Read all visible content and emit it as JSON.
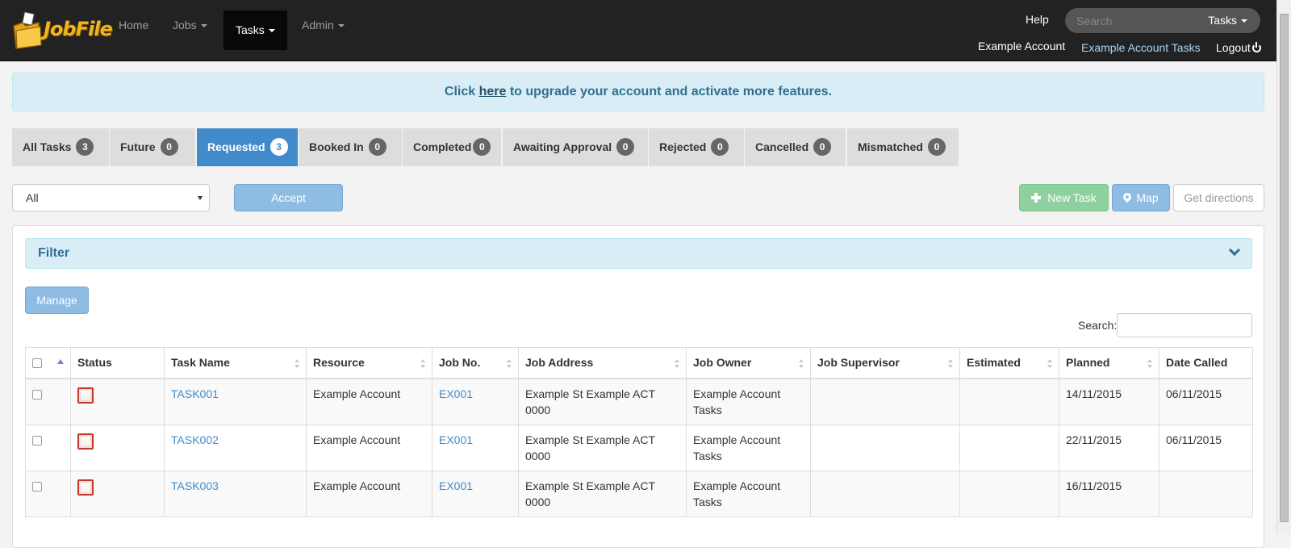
{
  "navbar": {
    "brand": "JobFile",
    "items": [
      {
        "label": "Home",
        "dropdown": false
      },
      {
        "label": "Jobs",
        "dropdown": true
      },
      {
        "label": "Tasks",
        "dropdown": true,
        "active": true
      },
      {
        "label": "Admin",
        "dropdown": true
      }
    ],
    "help": "Help",
    "search_placeholder": "Search",
    "search_scope": "Tasks",
    "account": "Example Account",
    "account_tasks": "Example Account Tasks",
    "logout": "Logout"
  },
  "alert": {
    "prefix": "Click ",
    "link": "here",
    "suffix": " to upgrade your account and activate more features."
  },
  "tabs": [
    {
      "label": "All Tasks",
      "count": "3"
    },
    {
      "label": "Future",
      "count": "0"
    },
    {
      "label": "Requested",
      "count": "3",
      "active": true
    },
    {
      "label": "Booked In",
      "count": "0"
    },
    {
      "label": "Completed",
      "count": "0"
    },
    {
      "label": "Awaiting Approval",
      "count": "0"
    },
    {
      "label": "Rejected",
      "count": "0"
    },
    {
      "label": "Cancelled",
      "count": "0"
    },
    {
      "label": "Mismatched",
      "count": "0"
    }
  ],
  "actions": {
    "select_value": "All",
    "accept": "Accept",
    "new_task": "New Task",
    "map": "Map",
    "get_directions": "Get directions"
  },
  "panel": {
    "filter": "Filter",
    "manage": "Manage",
    "search_label": "Search:"
  },
  "table": {
    "headers": [
      "Status",
      "Task Name",
      "Resource",
      "Job No.",
      "Job Address",
      "Job Owner",
      "Job Supervisor",
      "Estimated",
      "Planned",
      "Date Called"
    ],
    "rows": [
      {
        "task": "TASK001",
        "resource": "Example Account",
        "job_no": "EX001",
        "address": "Example St Example ACT 0000",
        "owner": "Example Account Tasks",
        "supervisor": "",
        "estimated": "",
        "planned": "14/11/2015",
        "called": "06/11/2015"
      },
      {
        "task": "TASK002",
        "resource": "Example Account",
        "job_no": "EX001",
        "address": "Example St Example ACT 0000",
        "owner": "Example Account Tasks",
        "supervisor": "",
        "estimated": "",
        "planned": "22/11/2015",
        "called": "06/11/2015"
      },
      {
        "task": "TASK003",
        "resource": "Example Account",
        "job_no": "EX001",
        "address": "Example St Example ACT 0000",
        "owner": "Example Account Tasks",
        "supervisor": "",
        "estimated": "",
        "planned": "16/11/2015",
        "called": ""
      }
    ]
  },
  "colors": {
    "navbar": "#222222",
    "primary": "#428bca",
    "success": "#8fd19e",
    "info_bg": "#d9edf7",
    "status_icon": "#c0392b"
  }
}
